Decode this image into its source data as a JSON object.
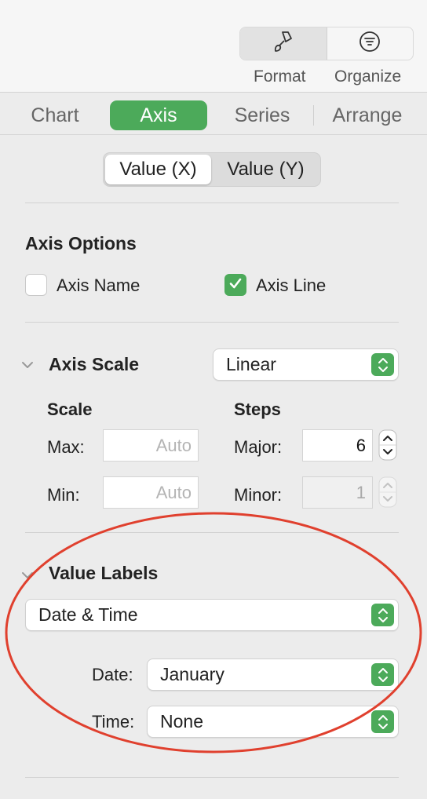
{
  "toolbar": {
    "format_label": "Format",
    "organize_label": "Organize",
    "format_icon": "paintbrush-icon",
    "organize_icon": "filter-lines-icon"
  },
  "tabs": [
    {
      "label": "Chart",
      "active": false
    },
    {
      "label": "Axis",
      "active": true
    },
    {
      "label": "Series",
      "active": false
    },
    {
      "label": "Arrange",
      "active": false
    }
  ],
  "axis_selector": {
    "options": [
      "Value (X)",
      "Value (Y)"
    ],
    "selected": "Value (X)"
  },
  "axis_options": {
    "title": "Axis Options",
    "axis_name_label": "Axis Name",
    "axis_name_checked": false,
    "axis_line_label": "Axis Line",
    "axis_line_checked": true
  },
  "axis_scale": {
    "title": "Axis Scale",
    "scale_type": "Linear",
    "scale_header": "Scale",
    "steps_header": "Steps",
    "max_label": "Max:",
    "max_placeholder": "Auto",
    "min_label": "Min:",
    "min_placeholder": "Auto",
    "major_label": "Major:",
    "major_value": "6",
    "minor_label": "Minor:",
    "minor_value": "1"
  },
  "value_labels": {
    "title": "Value Labels",
    "format": "Date & Time",
    "date_label": "Date:",
    "date_value": "January",
    "time_label": "Time:",
    "time_value": "None"
  },
  "colors": {
    "accent_green": "#4caa5a",
    "annotation_red": "#e0402e"
  }
}
